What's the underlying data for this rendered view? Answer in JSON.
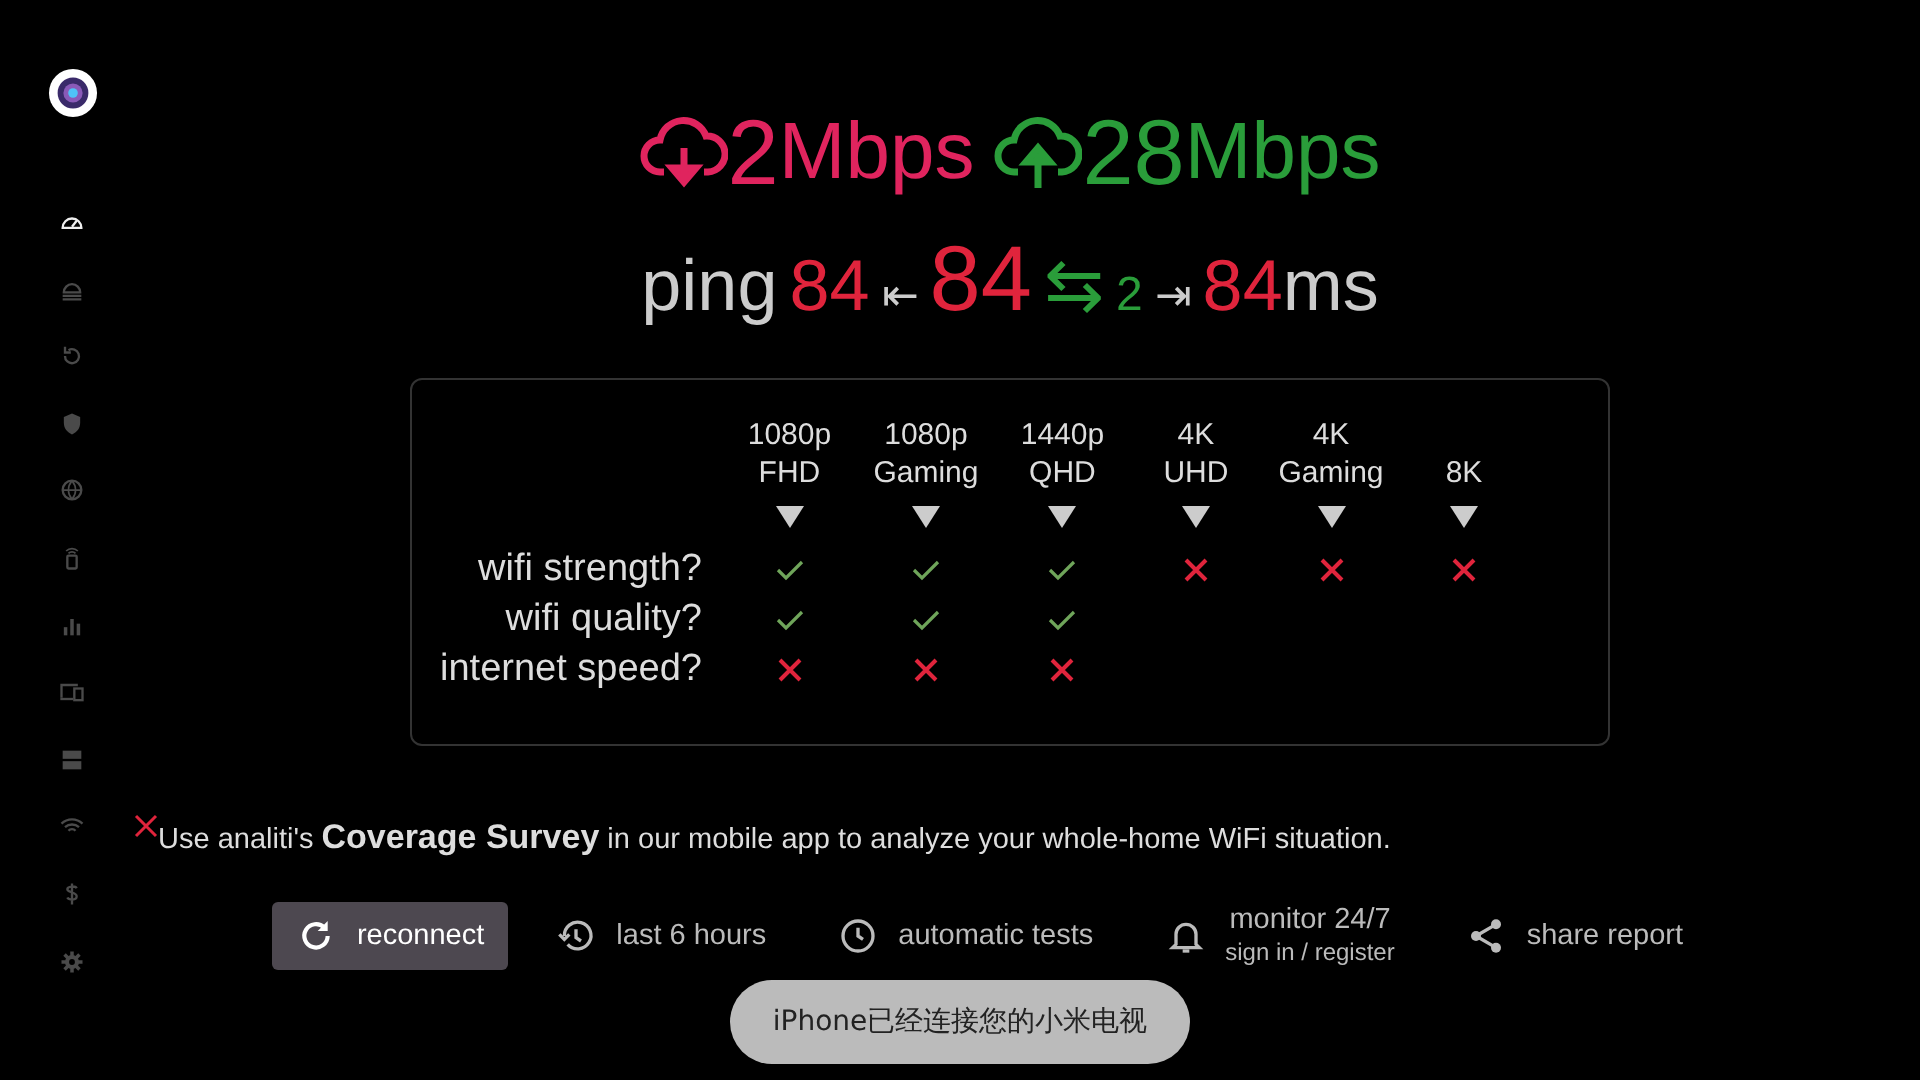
{
  "sidebar": {
    "items": [
      {
        "selected": true
      },
      {
        "selected": false
      },
      {
        "selected": false
      },
      {
        "selected": false
      },
      {
        "selected": false
      },
      {
        "selected": false
      },
      {
        "selected": false
      },
      {
        "selected": false
      },
      {
        "selected": false
      },
      {
        "selected": false
      },
      {
        "selected": false
      },
      {
        "selected": false
      }
    ]
  },
  "speed": {
    "download": {
      "value": "2",
      "unit": "Mbps"
    },
    "upload": {
      "value": "28",
      "unit": "Mbps"
    }
  },
  "ping": {
    "label": "ping",
    "low": "84",
    "low_arrow": "⇤",
    "main": "84",
    "jitter_arrow": "⇆",
    "jitter": "2",
    "high_arrow": "⇥",
    "high": "84",
    "unit": "ms"
  },
  "matrix": {
    "columns": [
      {
        "lines": [
          "1080p",
          "FHD"
        ]
      },
      {
        "lines": [
          "1080p",
          "Gaming"
        ]
      },
      {
        "lines": [
          "1440p",
          "QHD"
        ]
      },
      {
        "lines": [
          "4K",
          "UHD"
        ]
      },
      {
        "lines": [
          "4K",
          "Gaming"
        ]
      },
      {
        "lines": [
          "8K"
        ]
      }
    ],
    "rows": [
      {
        "label": "wifi strength?",
        "cells": [
          {
            "ok": true
          },
          {
            "ok": true
          },
          {
            "ok": true
          },
          {
            "ok": false
          },
          {
            "ok": false
          },
          {
            "ok": false
          }
        ]
      },
      {
        "label": "wifi quality?",
        "cells": [
          {
            "ok": true
          },
          {
            "ok": true
          },
          {
            "ok": true
          }
        ]
      },
      {
        "label": "internet speed?",
        "cells": [
          {
            "ok": false
          },
          {
            "ok": false
          },
          {
            "ok": false
          }
        ]
      }
    ]
  },
  "note": "Use analiti's **Coverage Survey** in our mobile app to analyze your whole-home WiFi situation.",
  "actions": [
    {
      "kind": "reconnect",
      "label": "reconnect",
      "selected": true
    },
    {
      "kind": "history",
      "label": "last 6 hours",
      "selected": false
    },
    {
      "kind": "auto",
      "label": "automatic tests",
      "selected": false
    },
    {
      "kind": "monitor",
      "label": "monitor 24/7",
      "sub": "sign in / register",
      "selected": false
    },
    {
      "kind": "share",
      "label": "share report",
      "selected": false
    }
  ],
  "toast": "iPhone已经连接您的小米电视"
}
